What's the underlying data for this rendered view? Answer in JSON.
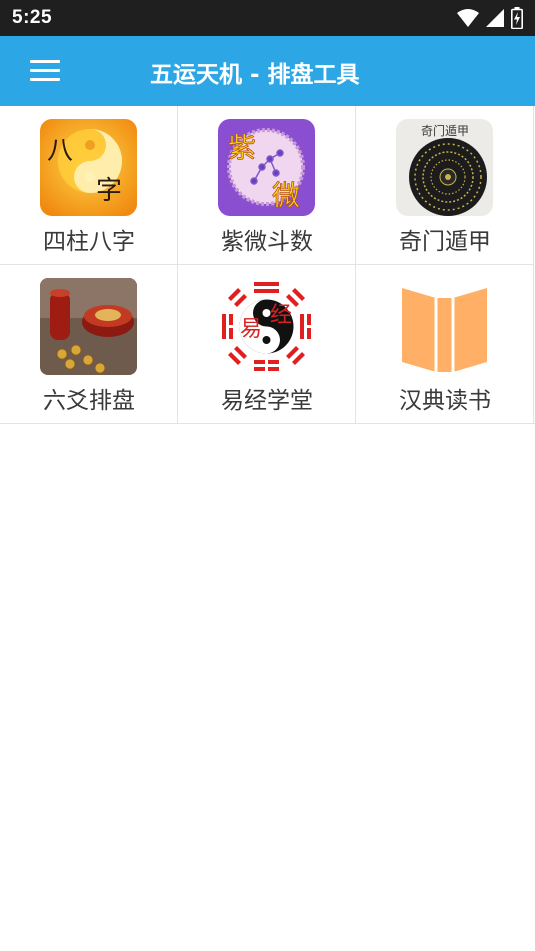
{
  "status_bar": {
    "time": "5:25",
    "icons": [
      "wifi-icon",
      "signal-icon",
      "battery-charging-icon"
    ]
  },
  "app_bar": {
    "title": "五运天机 - 排盘工具",
    "menu_icon": "hamburger-menu-icon",
    "background_color": "#2da6e6"
  },
  "tools": [
    {
      "label": "四柱八字",
      "icon": "bazi-icon",
      "icon_text": [
        "八",
        "字"
      ]
    },
    {
      "label": "紫微斗数",
      "icon": "ziwei-icon",
      "icon_text": [
        "紫",
        "微"
      ]
    },
    {
      "label": "奇门遁甲",
      "icon": "qimen-dunjia-icon",
      "icon_text": [
        "奇门遁甲"
      ]
    },
    {
      "label": "六爻排盘",
      "icon": "liuyao-icon"
    },
    {
      "label": "易经学堂",
      "icon": "yijing-taiji-icon",
      "icon_text": [
        "易",
        "经"
      ]
    },
    {
      "label": "汉典读书",
      "icon": "open-book-icon"
    }
  ]
}
